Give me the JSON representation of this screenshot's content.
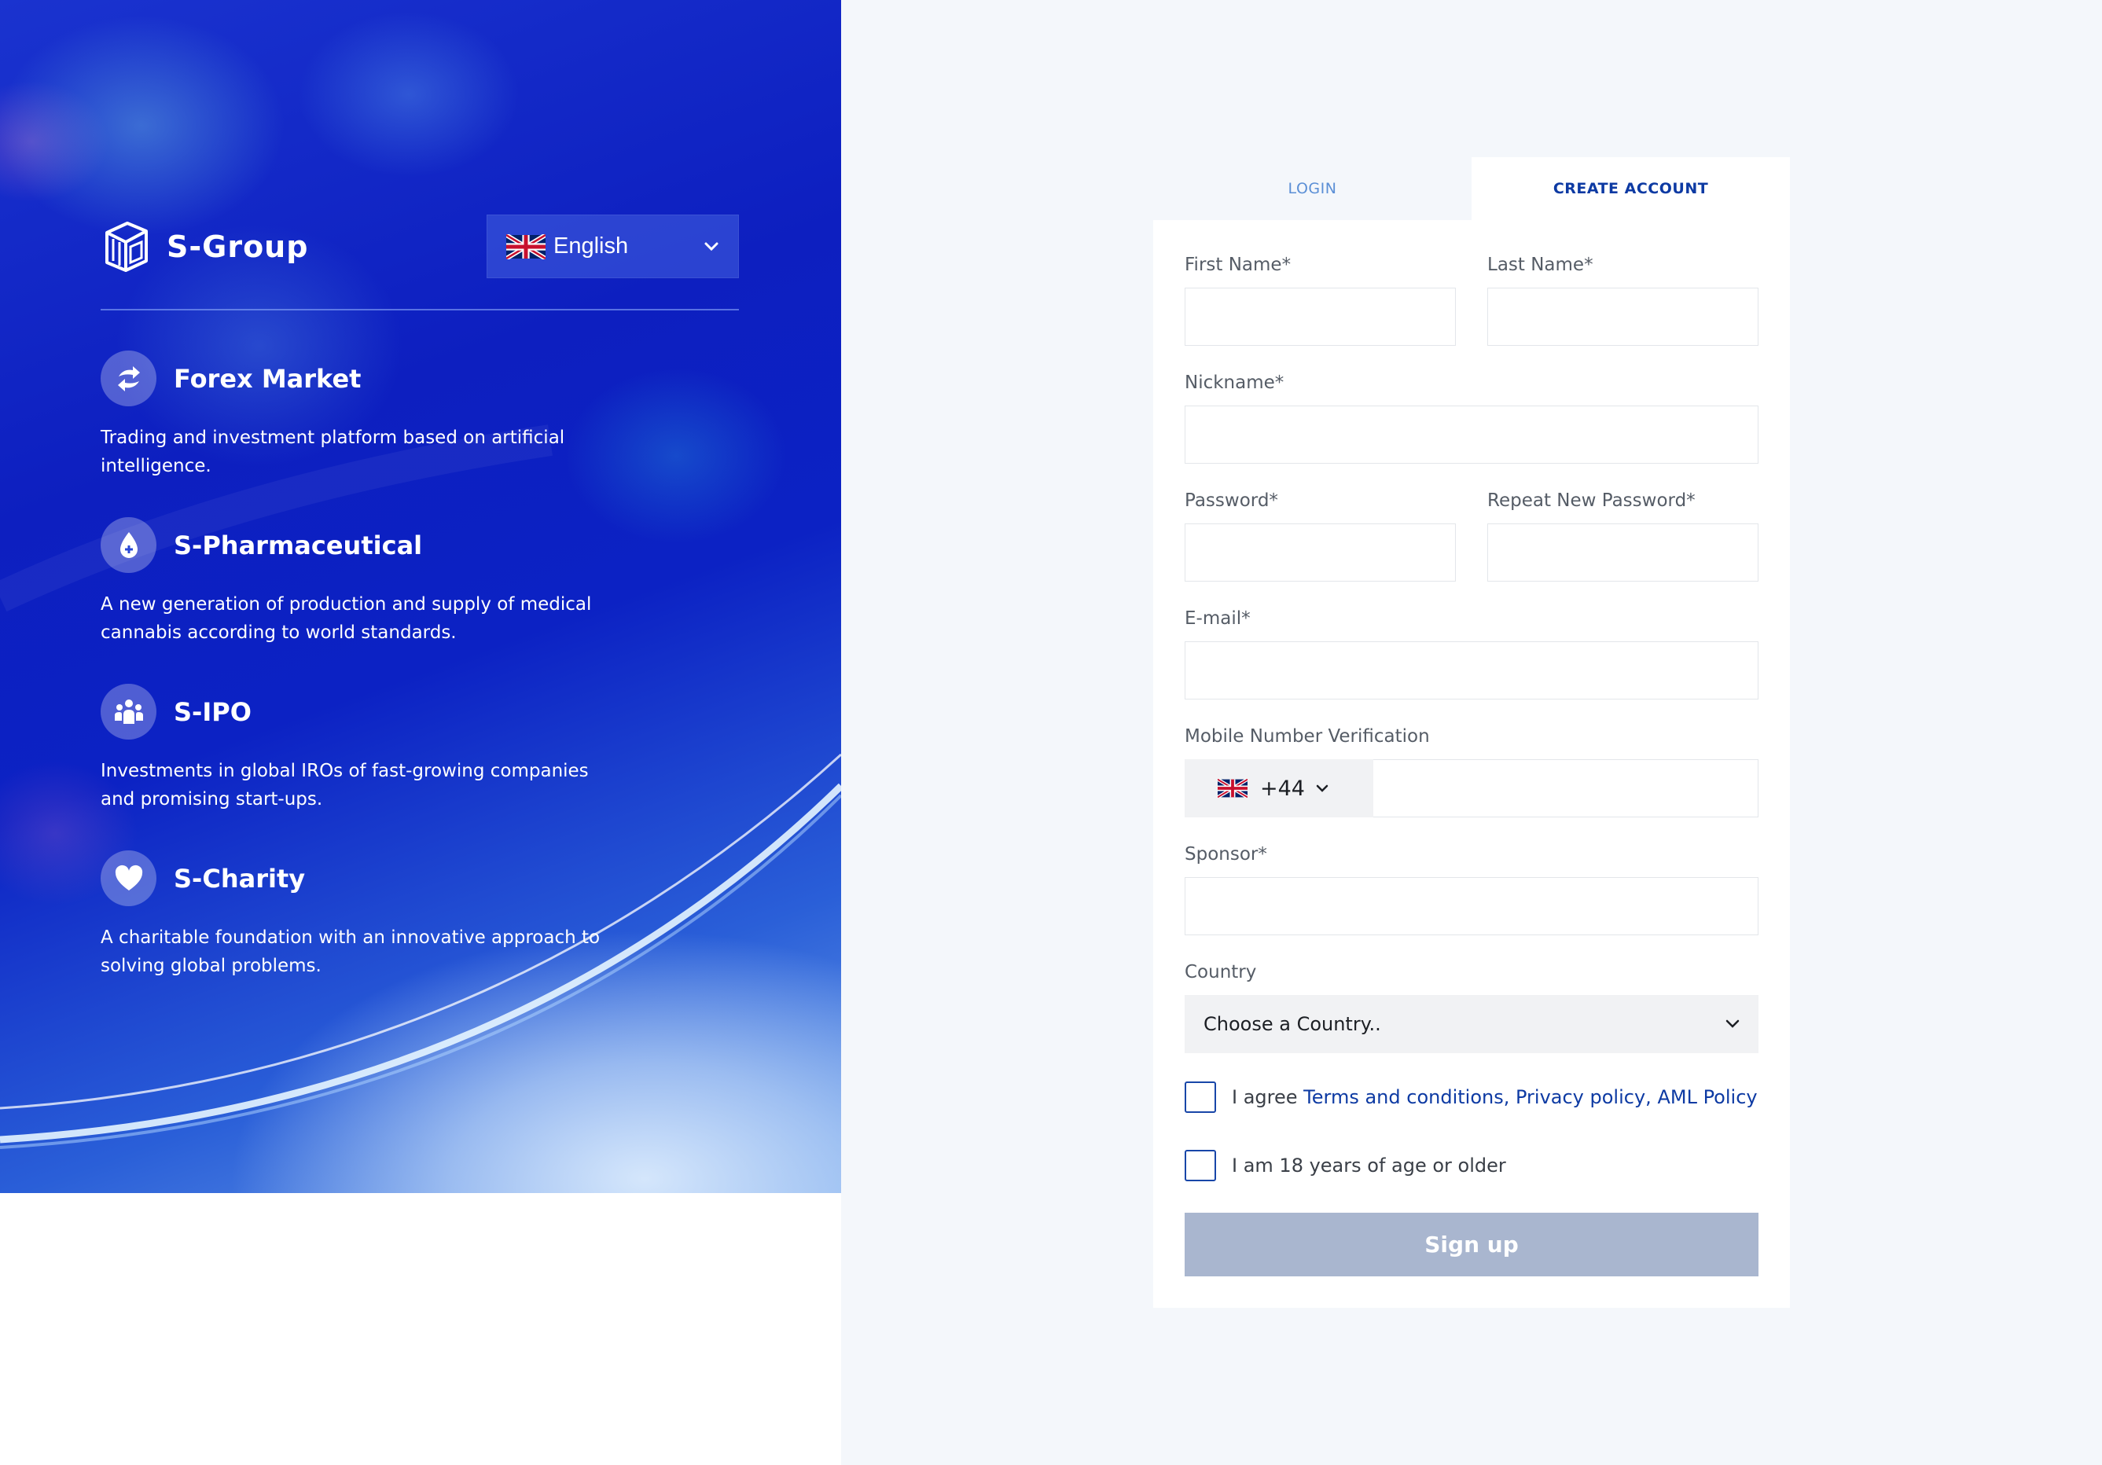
{
  "brand": {
    "name": "S-Group"
  },
  "language": {
    "selected": "English",
    "flag_icon": "uk-flag-icon"
  },
  "features": [
    {
      "icon": "exchange-arrows-icon",
      "title": "Forex Market",
      "description_lines": [
        "Trading and investment platform based on artificial",
        "intelligence."
      ]
    },
    {
      "icon": "medical-drop-icon",
      "title": "S-Pharmaceutical",
      "description_lines": [
        "A new generation of production and supply of medical",
        "cannabis according to world standards."
      ]
    },
    {
      "icon": "people-group-icon",
      "title": "S-IPO",
      "description_lines": [
        "Investments in global IROs of fast-growing companies",
        "and promising start-ups."
      ]
    },
    {
      "icon": "heart-icon",
      "title": "S-Charity",
      "description_lines": [
        "A charitable foundation with an innovative approach to",
        "solving global problems."
      ]
    }
  ],
  "tabs": {
    "login": "LOGIN",
    "create_account": "CREATE ACCOUNT",
    "active": "create_account"
  },
  "form": {
    "first_name_label": "First Name*",
    "last_name_label": "Last Name*",
    "nickname_label": "Nickname*",
    "password_label": "Password*",
    "repeat_password_label": "Repeat New Password*",
    "email_label": "E-mail*",
    "mobile_label": "Mobile Number Verification",
    "phone_code": "+44",
    "sponsor_label": "Sponsor*",
    "country_label": "Country",
    "country_placeholder": "Choose a Country..",
    "agree_prefix": "I agree ",
    "terms_link": "Terms and conditions,",
    "privacy_link": "Privacy policy,",
    "aml_link": "AML Policy",
    "age_label": "I am 18 years of age or older",
    "submit_label": "Sign up"
  },
  "colors": {
    "accent_blue": "#0d3aa3",
    "tab_inactive": "#5b8fd6",
    "button_disabled": "#a9b6cf",
    "hero_blue": "#0d1fc0"
  }
}
